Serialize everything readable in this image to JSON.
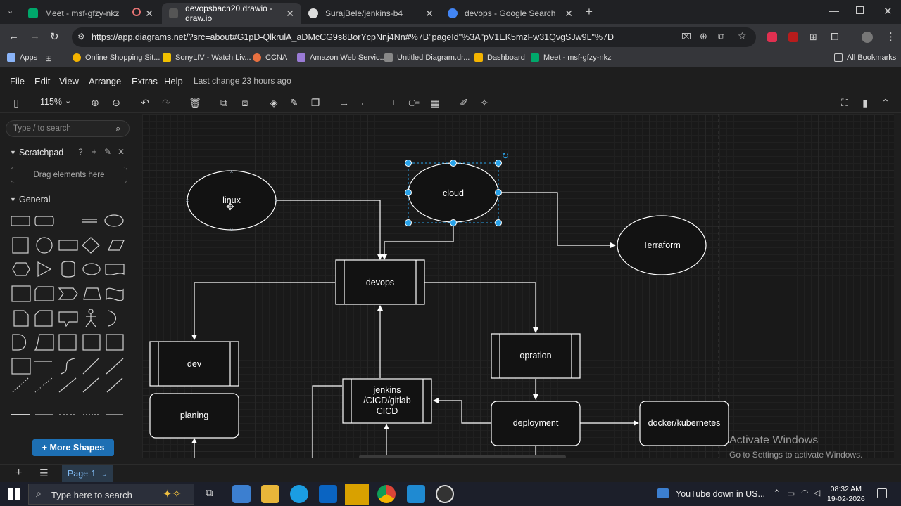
{
  "browser": {
    "tabs": [
      {
        "title": "Meet - msf-gfzy-nkz",
        "active": false
      },
      {
        "title": "devopsbach20.drawio - draw.io",
        "active": true
      },
      {
        "title": "SurajBele/jenkins-b4",
        "active": false
      },
      {
        "title": "devops - Google Search",
        "active": false
      }
    ],
    "url": "https://app.diagrams.net/?src=about#G1pD-QlkrulA_aDMcCG9s8BorYcpNnj4Nn#%7B\"pageId\"%3A\"pV1EK5mzFw31QvgSJw9L\"%7D",
    "bookmarks": [
      "Apps",
      "Online Shopping Sit...",
      "SonyLIV - Watch Liv...",
      "CCNA",
      "Amazon Web Servic...",
      "Untitled Diagram.dr...",
      "Dashboard",
      "Meet - msf-gfzy-nkz"
    ],
    "all_bookmarks": "All Bookmarks"
  },
  "drawio": {
    "menu": [
      "File",
      "Edit",
      "View",
      "Arrange",
      "Extras",
      "Help"
    ],
    "last_change": "Last change 23 hours ago",
    "zoom": "115%",
    "search_placeholder": "Type / to search",
    "scratchpad": "Scratchpad",
    "drag_here": "Drag elements here",
    "general": "General",
    "more_shapes": "+ More Shapes",
    "page_tab": "Page-1"
  },
  "diagram": {
    "nodes": {
      "linux": "linux",
      "cloud": "cloud",
      "terraform": "Terraform",
      "devops": "devops",
      "dev": "dev",
      "planing": "planing",
      "opration": "opration",
      "jenkins_l1": "jenkins",
      "jenkins_l2": "/CICD/gitlab",
      "jenkins_l3": "CICD",
      "deployment": "deployment",
      "docker": "docker/kubernetes"
    }
  },
  "system": {
    "activate_title": "Activate Windows",
    "activate_sub": "Go to Settings to activate Windows.",
    "taskbar_search": "Type here to search",
    "news": "YouTube down in US...",
    "time": "08:32 AM",
    "date": "19-02-2026"
  }
}
